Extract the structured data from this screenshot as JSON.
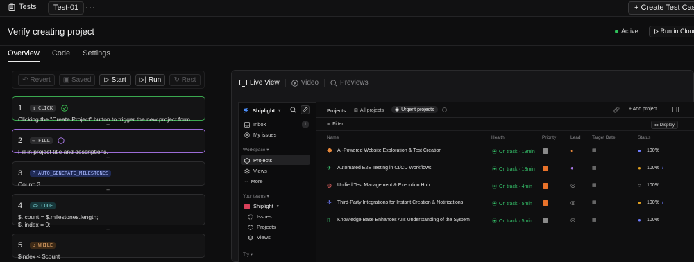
{
  "topbar": {
    "section": "Tests",
    "tab": "Test-01",
    "more": "···",
    "new_button": "Create Test Case"
  },
  "header": {
    "title": "Verify creating project",
    "status": "Active",
    "run_cloud": "Run in Cloud"
  },
  "tabs": [
    "Overview",
    "Code",
    "Settings"
  ],
  "toolbar": {
    "revert": "Revert",
    "saved": "Saved",
    "start": "Start",
    "run": "Run",
    "rest": "Rest"
  },
  "steps": [
    {
      "num": "1",
      "type": "CLICK",
      "desc": "Clicking the \"Create Project\" button to trigger the new project form."
    },
    {
      "num": "2",
      "type": "FILL",
      "desc": "Fill in project title and descriptions."
    },
    {
      "num": "3",
      "type": "AUTO_GENERATE_MILESTONES",
      "desc": "Count: 3"
    },
    {
      "num": "4",
      "type": "CODE",
      "desc_line1": "$. count = $.milestones.length;",
      "desc_line2": "$. index = 0;"
    },
    {
      "num": "5",
      "type": "WHILE",
      "desc": "$index < $count"
    }
  ],
  "plus": "+",
  "viewer_tabs": [
    "Live View",
    "Video",
    "Previews"
  ],
  "app": {
    "brand": "Shiplight",
    "sidebar": {
      "inbox": "Inbox",
      "inbox_count": "1",
      "my_issues": "My issues",
      "workspace_label": "Workspace",
      "projects": "Projects",
      "views": "Views",
      "more": "More",
      "teams_label": "Your teams",
      "team": "Shiplight",
      "team_issues": "Issues",
      "team_projects": "Projects",
      "team_views": "Views",
      "try_label": "Try"
    },
    "main": {
      "crumb": "Projects",
      "all_projects": "All projects",
      "urgent": "Urgent projects",
      "add_project": "Add project",
      "filter": "Filter",
      "display": "Display",
      "columns": [
        "Name",
        "Health",
        "Priority",
        "Lead",
        "Target Date",
        "Status"
      ],
      "rows": [
        {
          "name": "AI-Powered Website Exploration & Test Creation",
          "health": "On track · 19min",
          "priority_color": "#8a8a8a",
          "status": "100%",
          "status_color": "#6f7cff",
          "icon_color": "#e8883a"
        },
        {
          "name": "Automated E2E Testing in CI/CD Workflows",
          "health": "On track · 13min",
          "priority_color": "#e8722a",
          "status": "100%",
          "status_color": "#e0a020",
          "icon_color": "#3ab86a"
        },
        {
          "name": "Unified Test Management & Execution Hub",
          "health": "On track · 4min",
          "priority_color": "#e8722a",
          "status": "100%",
          "status_color": "#9a9a9a",
          "icon_color": "#e26060"
        },
        {
          "name": "Third-Party Integrations for Instant Creation & Notifications",
          "health": "On track · 5min",
          "priority_color": "#e8722a",
          "status": "100%",
          "status_color": "#e0a020",
          "icon_color": "#6f7cff"
        },
        {
          "name": "Knowledge Base Enhances AI's Understanding of the System",
          "health": "On track · 5min",
          "priority_color": "#8a8a8a",
          "status": "100%",
          "status_color": "#6f7cff",
          "icon_color": "#3ab86a"
        }
      ]
    }
  },
  "colors": {
    "green": "#2fbf5a",
    "step1_border": "#3aa84f",
    "step2_border": "#9b6bd6",
    "accent_blue": "#4a6cf7"
  }
}
